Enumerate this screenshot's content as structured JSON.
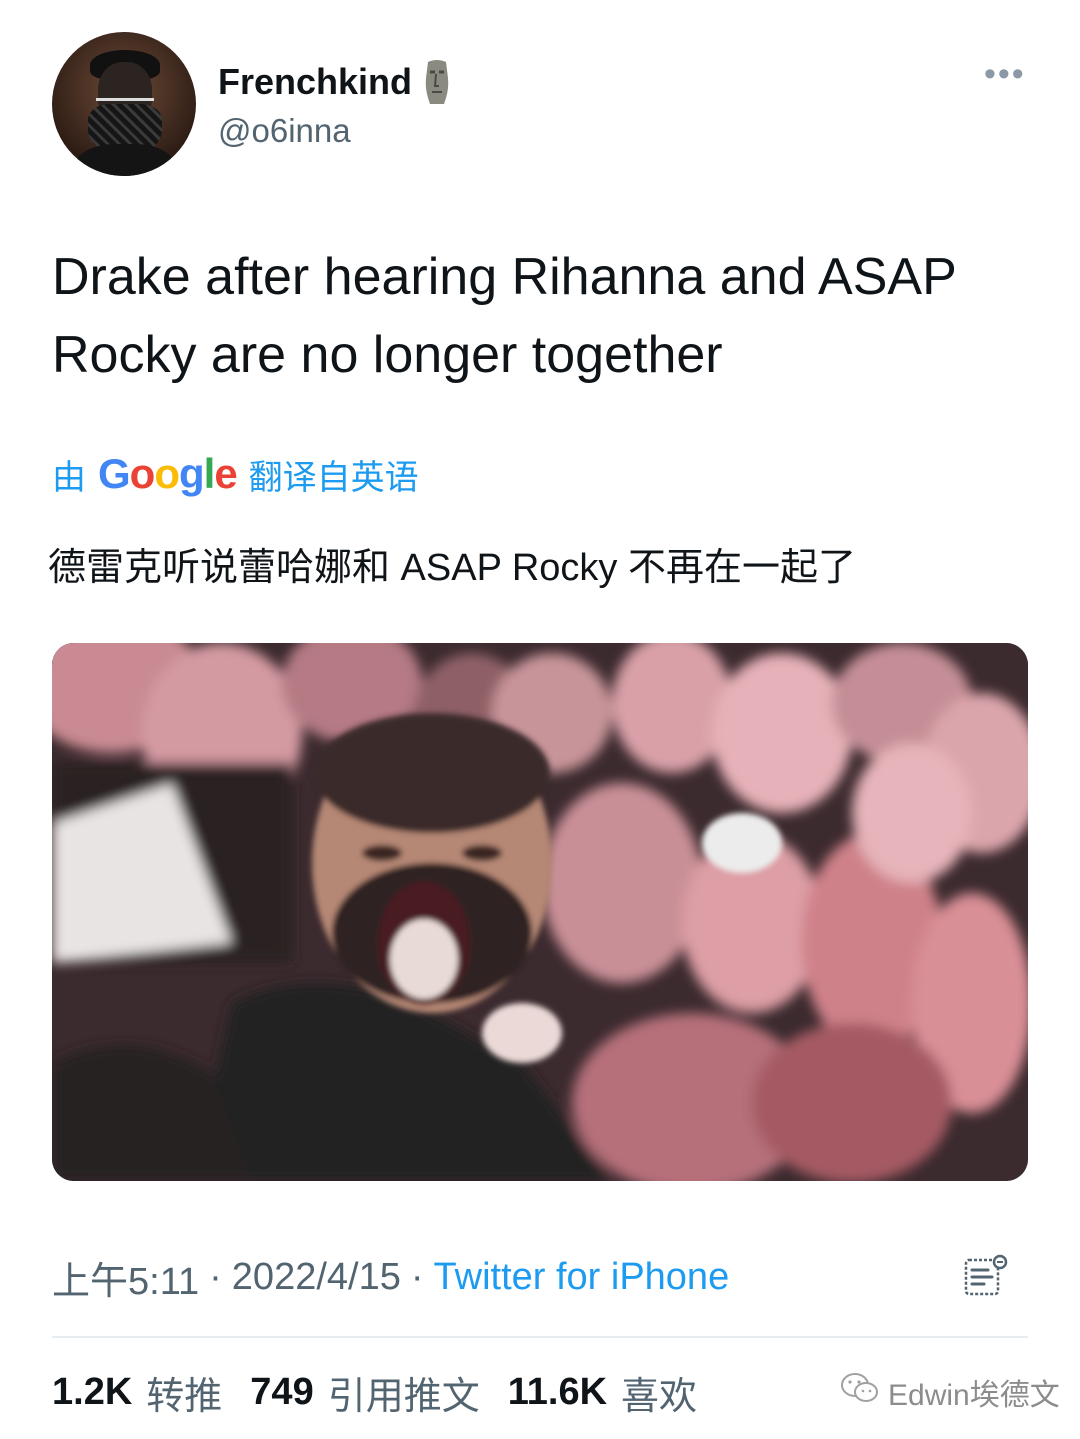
{
  "author": {
    "name": "Frenchkind",
    "handle": "@o6inna",
    "badge_icon": "moai-emoji",
    "more_icon": "more-horizontal-icon"
  },
  "tweet": {
    "text": "Drake after hearing Rihanna and ASAP Rocky are no longer together"
  },
  "translation": {
    "prefix": "由",
    "provider": "Google",
    "suffix": "翻译自英语",
    "text": "德雷克听说蕾哈娜和 ASAP Rocky 不再在一起了"
  },
  "meta": {
    "time": "上午5:11",
    "date": "2022/4/15",
    "source": "Twitter for iPhone",
    "separator": "·"
  },
  "stats": {
    "retweets": {
      "value": "1.2K",
      "label": "转推"
    },
    "quotes": {
      "value": "749",
      "label": "引用推文"
    },
    "likes": {
      "value": "11.6K",
      "label": "喜欢"
    }
  },
  "watermark": {
    "text": "Edwin埃德文",
    "icon": "wechat-icon"
  },
  "colors": {
    "accent": "#1d9bf0",
    "secondary_text": "#536471",
    "primary_text": "#0f1419"
  }
}
